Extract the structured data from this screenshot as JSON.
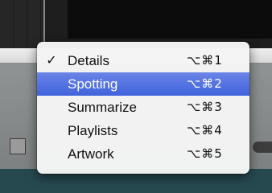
{
  "menu": {
    "items": [
      {
        "label": "Details",
        "shortcut": "⌥⌘1",
        "checked": "✓"
      },
      {
        "label": "Spotting",
        "shortcut": "⌥⌘2",
        "checked": ""
      },
      {
        "label": "Summarize",
        "shortcut": "⌥⌘3",
        "checked": ""
      },
      {
        "label": "Playlists",
        "shortcut": "⌥⌘4",
        "checked": ""
      },
      {
        "label": "Artwork",
        "shortcut": "⌥⌘5",
        "checked": ""
      }
    ],
    "selected_index": 1,
    "highlight_color": "#4a6de0"
  }
}
